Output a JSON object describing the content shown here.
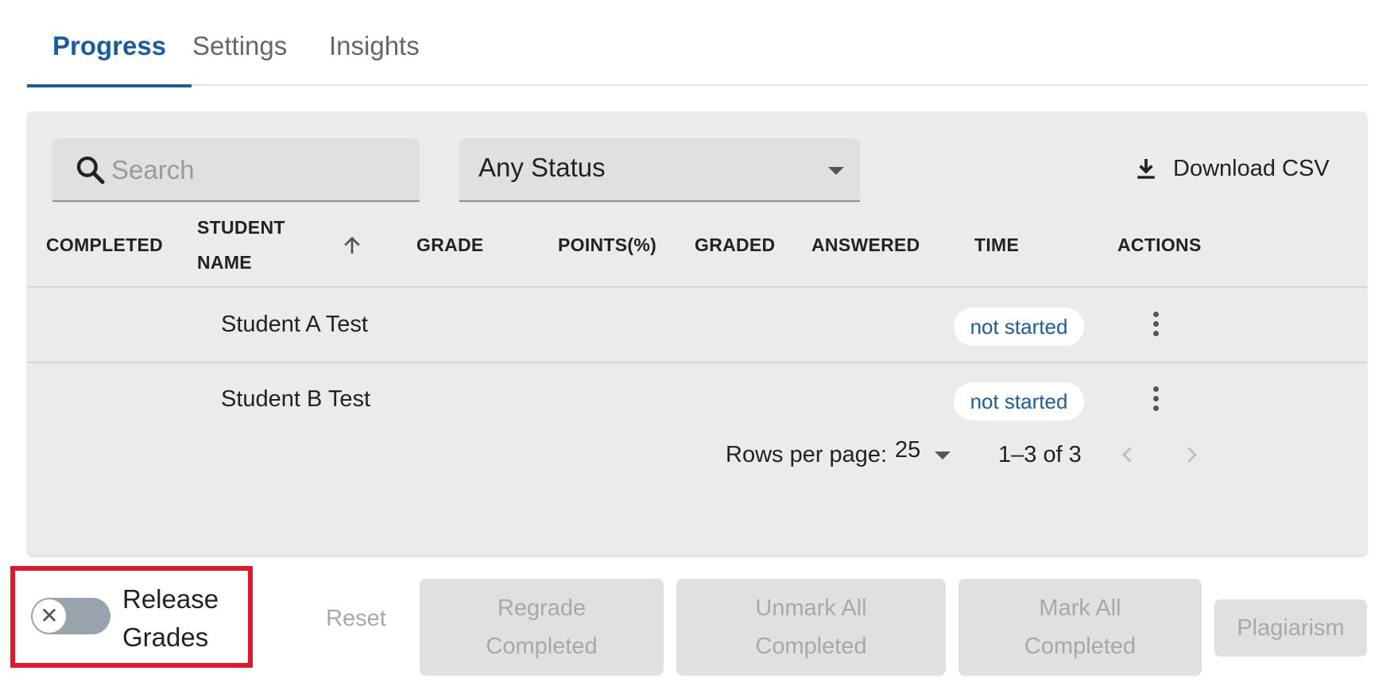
{
  "tabs": [
    {
      "label": "Progress",
      "active": true
    },
    {
      "label": "Settings",
      "active": false
    },
    {
      "label": "Insights",
      "active": false
    }
  ],
  "toolbar": {
    "search_placeholder": "Search",
    "status_value": "Any Status",
    "download_label": "Download CSV"
  },
  "table": {
    "columns": [
      "COMPLETED",
      "STUDENT",
      "NAME",
      "GRADE",
      "POINTS(%)",
      "GRADED",
      "ANSWERED",
      "TIME",
      "ACTIONS"
    ],
    "sort": {
      "column": "STUDENT NAME",
      "direction": "ascending"
    },
    "rows": [
      {
        "student_name": "Student A Test",
        "time": "not started"
      },
      {
        "student_name": "Student B Test",
        "time": "not started"
      }
    ]
  },
  "pagination": {
    "rows_per_page_label": "Rows per page:",
    "rows_per_page": "25",
    "range": "1–3 of 3"
  },
  "footer": {
    "release_grades_line1": "Release",
    "release_grades_line2": "Grades",
    "release_grades_on": false,
    "toggle_off_glyph": "✕",
    "reset": "Reset",
    "regrade_line1": "Regrade",
    "regrade_line2": "Completed",
    "unmark_line1": "Unmark All",
    "unmark_line2": "Completed",
    "mark_line1": "Mark All",
    "mark_line2": "Completed",
    "plagiarism": "Plagiarism"
  },
  "colors": {
    "accent": "#1a5c9e",
    "highlight_border": "#e0192c",
    "card_background": "#ebebeb"
  }
}
